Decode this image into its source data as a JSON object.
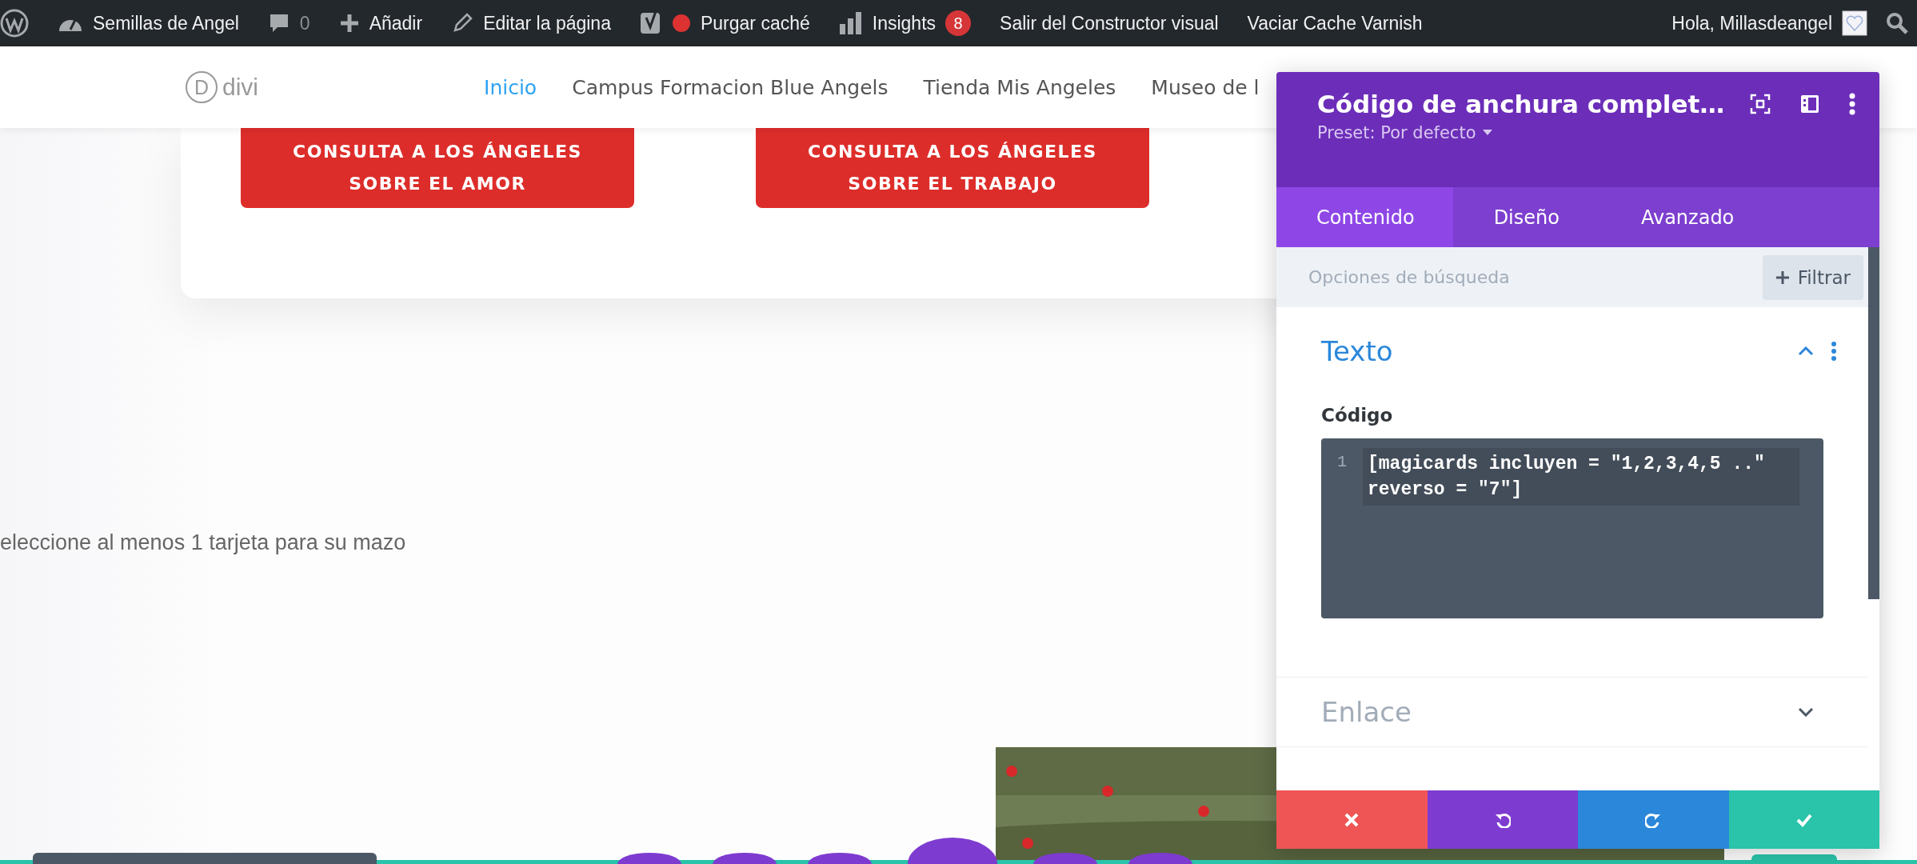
{
  "admin_bar": {
    "site_name": "Semillas de Angel",
    "comments": "0",
    "new": "Añadir",
    "edit": "Editar la página",
    "purge": "Purgar caché",
    "insights": "Insights",
    "insights_badge": "8",
    "exit_builder": "Salir del Constructor visual",
    "varnish": "Vaciar Cache Varnish",
    "greeting": "Hola, Millasdeangel"
  },
  "header": {
    "logo": {
      "mark": "D",
      "text": "divi"
    },
    "nav": [
      {
        "label": "Inicio",
        "selected": true
      },
      {
        "label": "Campus Formacion Blue Angels",
        "selected": false
      },
      {
        "label": "Tienda Mis Angeles",
        "selected": false
      },
      {
        "label": "Museo de l",
        "selected": false
      }
    ]
  },
  "page": {
    "cta_buttons": [
      "CONSULTA A LOS ÁNGELES\nSOBRE EL AMOR",
      "CONSULTA A LOS ÁNGELES\nSOBRE EL TRABAJO"
    ],
    "notice": "eleccione al menos 1 tarjeta para su mazo"
  },
  "panel": {
    "title": "Código de anchura complet…",
    "preset": "Preset: Por defecto",
    "tabs": [
      {
        "label": "Contenido",
        "selected": true
      },
      {
        "label": "Diseño",
        "selected": false
      },
      {
        "label": "Avanzado",
        "selected": false
      }
    ],
    "search": {
      "placeholder": "Opciones de búsqueda"
    },
    "filter_button": "Filtrar",
    "sections": [
      {
        "title": "Texto",
        "expanded": true,
        "field_label": "Código",
        "code": {
          "line_number": "1",
          "text": "[magicards incluyen = \"1,2,3,4,5 ..\" reverso = \"7\"]"
        }
      },
      {
        "title": "Enlace",
        "expanded": false
      }
    ],
    "actions": [
      {
        "kind": "discard"
      },
      {
        "kind": "undo"
      },
      {
        "kind": "redo"
      },
      {
        "kind": "save"
      }
    ]
  }
}
